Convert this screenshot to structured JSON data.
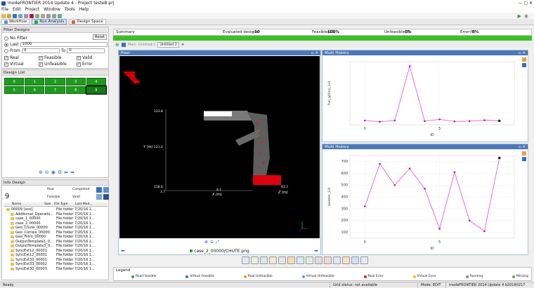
{
  "window": {
    "title": "modeFRONTIER 2014 Update 4 - Project testeB.prj"
  },
  "menu": [
    "File",
    "Edit",
    "Project",
    "Window",
    "Tools",
    "Help"
  ],
  "app_tabs": [
    {
      "label": "Workflow"
    },
    {
      "label": "Run Analysis"
    },
    {
      "label": "Design Space"
    }
  ],
  "filter": {
    "title": "Filter Designs",
    "reset": "Reset",
    "no_filter": "No Filter",
    "last_label": "Last",
    "last_value": "1000",
    "from_label": "From",
    "from_value": "0",
    "to_label": "To",
    "to_value": "0",
    "checks": [
      {
        "label": "Real",
        "checked": true
      },
      {
        "label": "Feasible",
        "checked": true
      },
      {
        "label": "Valid",
        "checked": true
      },
      {
        "label": "Virtual",
        "checked": true
      },
      {
        "label": "Unfeasible",
        "checked": true
      },
      {
        "label": "Error",
        "checked": true
      }
    ]
  },
  "design_list": {
    "title": "Design List",
    "cells": [
      "0",
      "1",
      "2",
      "3",
      "4",
      "5",
      "6",
      "7",
      "8",
      "9"
    ]
  },
  "info": {
    "title": "Info Design",
    "number": "9",
    "real": "Real",
    "completed": "Completed",
    "feasible": "Feasible",
    "valid": "Valid"
  },
  "tree": {
    "headers": [
      "Name",
      "Size",
      "File Type",
      "Last Mod..."
    ],
    "rows": [
      {
        "name": "00009 [xxx]",
        "type": "File folder 7/20/16 1..."
      },
      {
        "name": "Additional_Operatio...",
        "type": "File folder 7/20/16 1..."
      },
      {
        "name": "case_1_00000",
        "type": "File folder 7/20/16 1..."
      },
      {
        "name": "case_2_00000",
        "type": "File folder 7/20/16 1..."
      },
      {
        "name": "Geo_Chute_00000",
        "type": "File folder 7/20/16 1..."
      },
      {
        "name": "Geo_Correia_00000",
        "type": "File folder 7/20/16 1..."
      },
      {
        "name": "Geo_Filtro_00000",
        "type": "File folder 7/20/16 1..."
      },
      {
        "name": "OutputTemplate1_0...",
        "type": "File folder 7/20/16 1..."
      },
      {
        "name": "OutputTemplate3_0...",
        "type": "File folder 7/20/16 1..."
      },
      {
        "name": "SyncExt12_00001",
        "type": "File folder 7/20/16 1..."
      },
      {
        "name": "SyncExt12_00001",
        "type": "File folder 7/20/16 1..."
      },
      {
        "name": "SyncExt33_00001",
        "type": "File folder 7/20/16 1..."
      },
      {
        "name": "SyncExt33_00002",
        "type": "File folder 7/20/16 1..."
      },
      {
        "name": "SyncExt30_00003",
        "type": "File folder 7/20/16 1..."
      }
    ]
  },
  "summary": {
    "label": "Summary",
    "evaluated": "Evaluated designs:",
    "evaluated_val": "10",
    "feasible": "Feasible(10):",
    "feasible_val": "100%",
    "unfeasible": "Unfeasible(0):",
    "unfeasible_val": "0%",
    "error": "Error(0):",
    "error_val": "0%"
  },
  "doc_tabs": [
    {
      "label": "Main"
    },
    {
      "label": "Untitled 1"
    },
    {
      "label": "Untitled 2"
    }
  ],
  "pixel_window": {
    "title": "Pixel",
    "caption": "case_2_00000/CHUTE.png",
    "axes": {
      "top": "123.8",
      "mid": "121.2",
      "bot": "118.6",
      "bot2": "3.7",
      "y": "Y (m)",
      "x": "X (m)",
      "z": "Z (m)",
      "xval": "4.1",
      "zval": "83.7"
    }
  },
  "chart_top": {
    "title": "Multi History",
    "ylabel": "Pull_q(fres)_1/4",
    "xlabel": "ID"
  },
  "chart_bottom": {
    "title": "Multi History",
    "ylabel": "Usiloter_1/4",
    "xlabel": "ID"
  },
  "chart_data": [
    {
      "type": "line",
      "title": "",
      "ylabel": "Pull_q(fres)_1/4",
      "xlabel": "ID",
      "x": [
        0,
        1,
        2,
        3,
        4,
        5,
        6,
        7,
        8,
        9
      ],
      "y": [
        0.4,
        0.0,
        0.4,
        18.5,
        0.2,
        0.8,
        0.1,
        0.2,
        0.5,
        0.3
      ],
      "xlim": [
        -1,
        10
      ],
      "ylim": [
        -1,
        20
      ],
      "xticks": [
        "0",
        "5"
      ],
      "yticks": []
    },
    {
      "type": "line",
      "title": "",
      "ylabel": "Usiloter_1/4",
      "xlabel": "ID",
      "x": [
        0,
        1,
        2,
        3,
        4,
        5,
        6,
        7,
        8,
        9
      ],
      "y": [
        320,
        680,
        500,
        640,
        470,
        130,
        610,
        200,
        110,
        730
      ],
      "xlim": [
        -1,
        10
      ],
      "ylim": [
        50,
        750
      ],
      "xticks": [
        "0",
        "5"
      ],
      "yticks": [
        "100",
        "200",
        "300",
        "400",
        "500",
        "600",
        "700"
      ]
    }
  ],
  "legend": {
    "title": "Legend",
    "items": [
      {
        "label": "Real Feasible",
        "color": "#3a9f3a"
      },
      {
        "label": "Virtual Feasible",
        "color": "#2f6fd0"
      },
      {
        "label": "Real Unfeasible",
        "color": "#e2a11a"
      },
      {
        "label": "Virtual Unfeasible",
        "color": "#5aa0e0"
      },
      {
        "label": "Real Error",
        "color": "#d22"
      },
      {
        "label": "Virtual Error",
        "color": "#e8c51f"
      },
      {
        "label": "Running",
        "color": "#888"
      },
      {
        "label": "Missing",
        "color": "#5a5"
      }
    ]
  },
  "status": {
    "left": "Ready",
    "grid": "Grid status: not available",
    "mode": "Mode: EDIT",
    "version": "modeFRONTIER 2014 Update 4 b20160217"
  }
}
